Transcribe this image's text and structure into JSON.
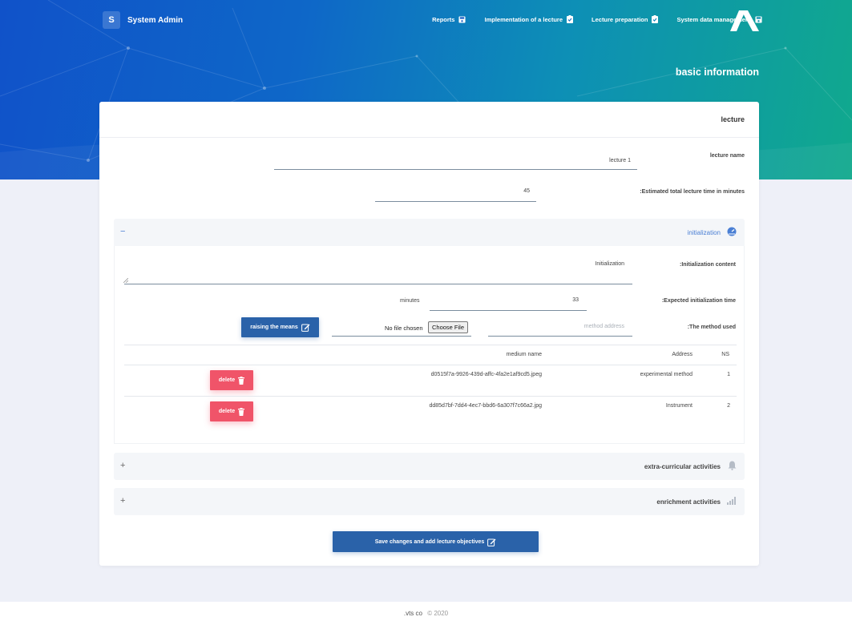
{
  "header": {
    "brand_initial": "S",
    "brand_name": "System Admin",
    "nav": [
      {
        "label": "Reports",
        "icon": "save-icon"
      },
      {
        "label": "Implementation of a lecture",
        "icon": "clipboard-check-icon"
      },
      {
        "label": "Lecture preparation",
        "icon": "clipboard-check-icon"
      },
      {
        "label": "System data management",
        "icon": "save-icon"
      }
    ],
    "page_title": "basic information"
  },
  "card": {
    "title": "lecture",
    "lecture_name": {
      "label": "lecture name",
      "value": "lecture 1"
    },
    "estimated_time": {
      "label": ":Estimated total lecture time in minutes",
      "value": "45"
    }
  },
  "initialization": {
    "title": "initialization",
    "toggle": "−",
    "content": {
      "label": ":Initialization content",
      "value": "Initialization"
    },
    "expected_time": {
      "label": ":Expected initialization time",
      "value": "33",
      "unit": "minutes"
    },
    "method": {
      "label": ":The method used",
      "address_placeholder": "method address",
      "file_status": "No file chosen",
      "file_button": "Choose File",
      "raise_button": "raising the means"
    },
    "table": {
      "headers": {
        "ns": "NS",
        "address": "Address",
        "medium": "medium name"
      },
      "rows": [
        {
          "ns": "1",
          "address": "experimental method",
          "medium": "d0515f7a-9926-439d-affc-4fa2e1af9cd5.jpeg",
          "delete": "delete"
        },
        {
          "ns": "2",
          "address": "Instrument",
          "medium": "dd85d7bf-7dd4-4ec7-bbd6-6a307f7c66a2.jpg",
          "delete": "delete"
        }
      ]
    }
  },
  "sections": [
    {
      "title": "extra-curricular activities",
      "toggle": "+",
      "icon": "bell-icon"
    },
    {
      "title": "enrichment activities",
      "toggle": "+",
      "icon": "signal-icon"
    }
  ],
  "save_button": "Save changes and add lecture objectives",
  "footer": {
    "brand": ".vts co",
    "copyright": "© 2020"
  },
  "colors": {
    "primary": "#2a62a9",
    "danger": "#f05469",
    "accent": "#4a7fd4"
  }
}
